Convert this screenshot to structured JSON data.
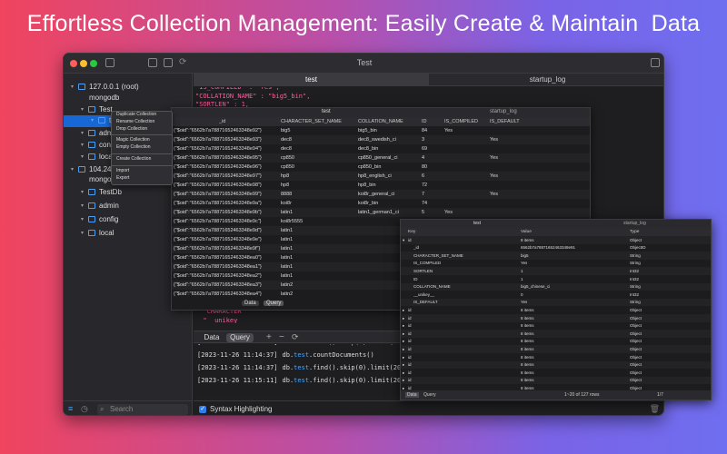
{
  "headline": "Effortless Collection Management: Easily Create & Maintain  Data",
  "window": {
    "title": "Test"
  },
  "sidebar": {
    "tree": [
      {
        "label": "127.0.0.1 (root)",
        "level": 0
      },
      {
        "label": "mongodb",
        "level": 0
      },
      {
        "label": "Test",
        "level": 1
      },
      {
        "label": "test",
        "level": 2
      },
      {
        "label": "admin",
        "level": 1
      },
      {
        "label": "config",
        "level": 1
      },
      {
        "label": "local",
        "level": 1
      },
      {
        "label": "104.248",
        "level": 0
      },
      {
        "label": "mongodb",
        "level": 0
      },
      {
        "label": "TestDb",
        "level": 1
      },
      {
        "label": "admin",
        "level": 1
      },
      {
        "label": "config",
        "level": 1
      },
      {
        "label": "local",
        "level": 1
      }
    ],
    "search_placeholder": "Search"
  },
  "context_menu": {
    "items": [
      "Duplicate Collection",
      "Rename Collection",
      "Drop Collection",
      "Magic Collection",
      "Empty Collection",
      "Create Collection",
      "Import",
      "Export"
    ]
  },
  "tabs": [
    "test",
    "startup_log"
  ],
  "editor": {
    "lines": [
      [
        "\"IS_COMPILED\" : \"Yes\",",
        0
      ],
      [
        "\"COLLATION_NAME\" : \"big5_bin\",",
        0
      ],
      [
        "\"SORTLEN\" : 1,",
        0
      ],
      [
        "\"IS_DEFAUL",
        0
      ],
      [
        "}",
        1
      ],
      [
        "",
        1
      ],
      [
        "/* 3 */",
        2
      ],
      [
        "{",
        1
      ],
      [
        "  \"IS_DEFAUL",
        0
      ],
      [
        "  \"__unikey_",
        0
      ],
      [
        "  \"COLLATION",
        0
      ],
      [
        "  \"SORTLEN",
        0
      ],
      [
        "  \"ID\" : 3,",
        0
      ],
      [
        "  \"_id\" : {",
        0
      ],
      [
        "    \"$oid\" :",
        0
      ],
      [
        "  },",
        1
      ],
      [
        "  \"CHARACTER",
        0
      ],
      [
        "  \"IS_COMPIL",
        0
      ],
      [
        "}",
        1
      ],
      [
        "",
        1
      ],
      [
        "/* 4 */",
        2
      ],
      [
        "{",
        1
      ],
      [
        "  \"ID\" : 69,",
        0
      ],
      [
        "  \"_id\" : {",
        0
      ],
      [
        "    \"$oid\" :",
        0
      ],
      [
        "  },",
        1
      ],
      [
        "  \"CHARACTER",
        0
      ],
      [
        "  \"__unikey_",
        0
      ],
      [
        "  \"IS_COMPIL",
        0
      ],
      [
        "  \"COLLATION_NAME\" : \"dec8_bin\",",
        0
      ],
      [
        "  \"SORTLEN\" : 0,",
        0
      ],
      [
        "  \"IS_DEFAULT\" : \"\"",
        0
      ]
    ]
  },
  "table1": {
    "tabs": [
      "test",
      "startup_log"
    ],
    "columns": [
      "_id",
      "CHARACTER_SET_NAME",
      "COLLATION_NAME",
      "ID",
      "IS_COMPILED",
      "IS_DEFAULT"
    ],
    "rows": [
      [
        "{\"$oid\":\"6562b7a78871652463348e92\"}",
        "big5",
        "big5_bin",
        "84",
        "Yes",
        ""
      ],
      [
        "{\"$oid\":\"6562b7a78871652463348e93\"}",
        "dec8",
        "dec8_swedish_ci",
        "3",
        "",
        "Yes"
      ],
      [
        "{\"$oid\":\"6562b7a78871652463348e94\"}",
        "dec8",
        "dec8_bin",
        "69",
        "",
        ""
      ],
      [
        "{\"$oid\":\"6562b7a78871652463348e95\"}",
        "cp850",
        "cp850_general_ci",
        "4",
        "",
        "Yes"
      ],
      [
        "{\"$oid\":\"6562b7a78871652463348e96\"}",
        "cp850",
        "cp850_bin",
        "80",
        "",
        ""
      ],
      [
        "{\"$oid\":\"6562b7a78871652463348e97\"}",
        "hp8",
        "hp8_english_ci",
        "6",
        "",
        "Yes"
      ],
      [
        "{\"$oid\":\"6562b7a78871652463348e98\"}",
        "hp8",
        "hp8_bin",
        "72",
        "",
        ""
      ],
      [
        "{\"$oid\":\"6562b7a78871652463348e99\"}",
        "8888",
        "koi8r_general_ci",
        "7",
        "",
        "Yes"
      ],
      [
        "{\"$oid\":\"6562b7a78871652463348e9a\"}",
        "koi8r",
        "koi8r_bin",
        "74",
        "",
        ""
      ],
      [
        "{\"$oid\":\"6562b7a78871652463348e9b\"}",
        "latin1",
        "latin1_german1_ci",
        "5",
        "Yes",
        ""
      ],
      [
        "{\"$oid\":\"6562b7a78871652463348e9c\"}",
        "koi8r5555",
        "",
        "",
        "",
        ""
      ],
      [
        "{\"$oid\":\"6562b7a78871652463348e9d\"}",
        "latin1",
        "",
        "",
        "",
        ""
      ],
      [
        "{\"$oid\":\"6562b7a78871652463348e9e\"}",
        "latin1",
        "",
        "",
        "",
        ""
      ],
      [
        "{\"$oid\":\"6562b7a78871652463348e9f\"}",
        "latin1",
        "",
        "",
        "",
        ""
      ],
      [
        "{\"$oid\":\"6562b7a78871652463348ea0\"}",
        "latin1",
        "",
        "",
        "",
        ""
      ],
      [
        "{\"$oid\":\"6562b7a78871652463348ea1\"}",
        "latin1",
        "",
        "",
        "",
        ""
      ],
      [
        "{\"$oid\":\"6562b7a78871652463348ea2\"}",
        "latin1",
        "",
        "",
        "",
        ""
      ],
      [
        "{\"$oid\":\"6562b7a78871652463348ea3\"}",
        "latin2",
        "",
        "",
        "",
        ""
      ],
      [
        "{\"$oid\":\"6562b7a78871652463348ea4\"}",
        "latin2",
        "",
        "",
        "",
        ""
      ]
    ],
    "bottom": [
      "Data",
      "Query"
    ]
  },
  "table2": {
    "tabs": [
      "test",
      "startup_log"
    ],
    "columns": [
      "Key",
      "Value",
      "Type"
    ],
    "rows": [
      [
        "id",
        "8 items",
        "Object"
      ],
      [
        "_id",
        "6562b7a78871652463348e91",
        "ObjectID"
      ],
      [
        "CHARACTER_SET_NAME",
        "big5",
        "String"
      ],
      [
        "IS_COMPILED",
        "Yes",
        "String"
      ],
      [
        "SORTLEN",
        "1",
        "Int32"
      ],
      [
        "ID",
        "1",
        "Int32"
      ],
      [
        "COLLATION_NAME",
        "big5_chinese_ci",
        "String"
      ],
      [
        "__unikey__",
        "0",
        "Int32"
      ],
      [
        "IS_DEFAULT",
        "Yes",
        "String"
      ],
      [
        "id",
        "8 items",
        "Object"
      ],
      [
        "id",
        "8 items",
        "Object"
      ],
      [
        "id",
        "8 items",
        "Object"
      ],
      [
        "id",
        "8 items",
        "Object"
      ],
      [
        "id",
        "8 items",
        "Object"
      ],
      [
        "id",
        "8 items",
        "Object"
      ],
      [
        "id",
        "8 items",
        "Object"
      ],
      [
        "id",
        "8 items",
        "Object"
      ],
      [
        "id",
        "8 items",
        "Object"
      ],
      [
        "id",
        "8 items",
        "Object"
      ],
      [
        "id",
        "8 items",
        "Object"
      ]
    ],
    "bottom": [
      "Data",
      "Query"
    ],
    "pager": "1~20 of 127 rows",
    "page": "1/7"
  },
  "query_bar": {
    "segments": [
      "Data",
      "Query"
    ]
  },
  "console": {
    "lines": [
      [
        "[2023-11-26 11:14:37]",
        "db.",
        "test",
        ".find().skip(0).limit(20)"
      ],
      [
        "[2023-11-26 11:14:37]",
        "db.",
        "test",
        ".countDocuments()"
      ],
      [
        "[2023-11-26 11:14:37]",
        "db.",
        "test",
        ".find().skip(0).limit(20)"
      ],
      [
        "[2023-11-26 11:15:11]",
        "db.",
        "test",
        ".find().skip(0).limit(20)"
      ]
    ]
  },
  "status": {
    "syntax_label": "Syntax Highlighting"
  }
}
